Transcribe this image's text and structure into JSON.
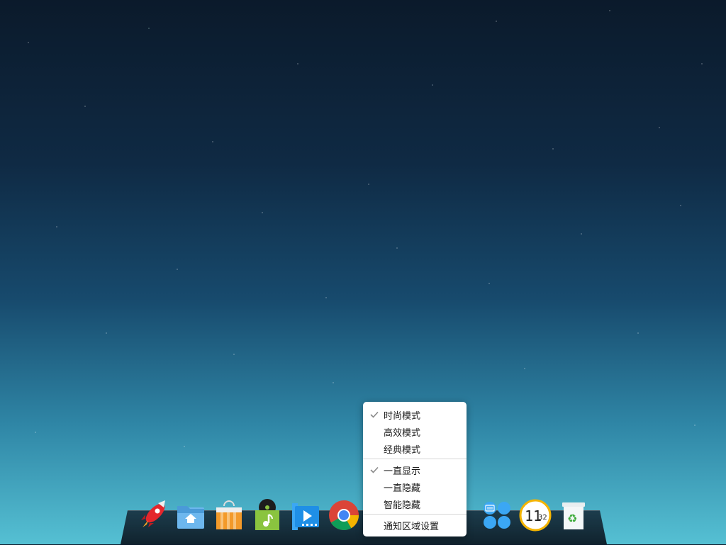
{
  "menu": {
    "items": [
      {
        "label": "时尚模式",
        "checked": true
      },
      {
        "label": "高效模式",
        "checked": false
      },
      {
        "label": "经典模式",
        "checked": false
      },
      {
        "label": "一直显示",
        "checked": true
      },
      {
        "label": "一直隐藏",
        "checked": false
      },
      {
        "label": "智能隐藏",
        "checked": false
      },
      {
        "label": "通知区域设置",
        "checked": false
      }
    ]
  },
  "dock": {
    "apps": [
      {
        "name": "launcher",
        "icon": "rocket-icon"
      },
      {
        "name": "file-manager",
        "icon": "home-folder-icon"
      },
      {
        "name": "app-store",
        "icon": "shopping-bag-icon"
      },
      {
        "name": "music",
        "icon": "music-note-icon"
      },
      {
        "name": "video-player",
        "icon": "video-play-icon"
      },
      {
        "name": "chrome",
        "icon": "chrome-icon"
      },
      {
        "name": "settings",
        "icon": "keyboard-grid-icon"
      },
      {
        "name": "clock",
        "icon": "clock-icon"
      },
      {
        "name": "trash",
        "icon": "trash-icon"
      }
    ],
    "clock_hour": "11",
    "clock_minute": "32"
  },
  "colors": {
    "accent_red": "#e4262c",
    "folder_blue": "#6db7ee",
    "bag_orange": "#f39a2a",
    "music_green": "#8ac43f",
    "video_blue": "#1f8fe6",
    "clock_gold": "#f4b400"
  }
}
